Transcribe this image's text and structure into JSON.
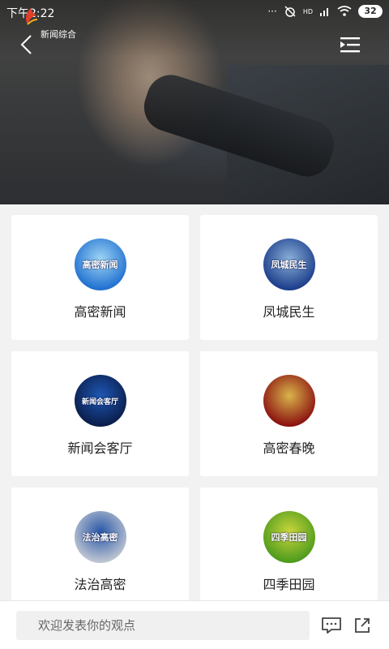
{
  "status_bar": {
    "time": "下午2:22",
    "network": "HD",
    "battery": "32"
  },
  "player": {
    "channel_name": "新闻综合"
  },
  "programs": [
    {
      "label": "高密新闻",
      "thumb_text": "高密新闻",
      "thumb_colors": [
        "#1f6fd0",
        "#9fd6f5"
      ]
    },
    {
      "label": "凤城民生",
      "thumb_text": "凤城民生",
      "thumb_colors": [
        "#1b3c8a",
        "#8ab0d8"
      ]
    },
    {
      "label": "新闻会客厅",
      "thumb_text": "新闻会客厅",
      "thumb_colors": [
        "#0b1d4a",
        "#1e57b4"
      ]
    },
    {
      "label": "高密春晚",
      "thumb_text": "",
      "thumb_colors": [
        "#8a1010",
        "#d9b44a"
      ]
    },
    {
      "label": "法治高密",
      "thumb_text": "法治高密",
      "thumb_colors": [
        "#bfc6d2",
        "#2857a8"
      ]
    },
    {
      "label": "四季田园",
      "thumb_text": "四季田园",
      "thumb_colors": [
        "#4c9a1d",
        "#c9d63a"
      ]
    }
  ],
  "comment": {
    "placeholder": "欢迎发表你的观点"
  }
}
